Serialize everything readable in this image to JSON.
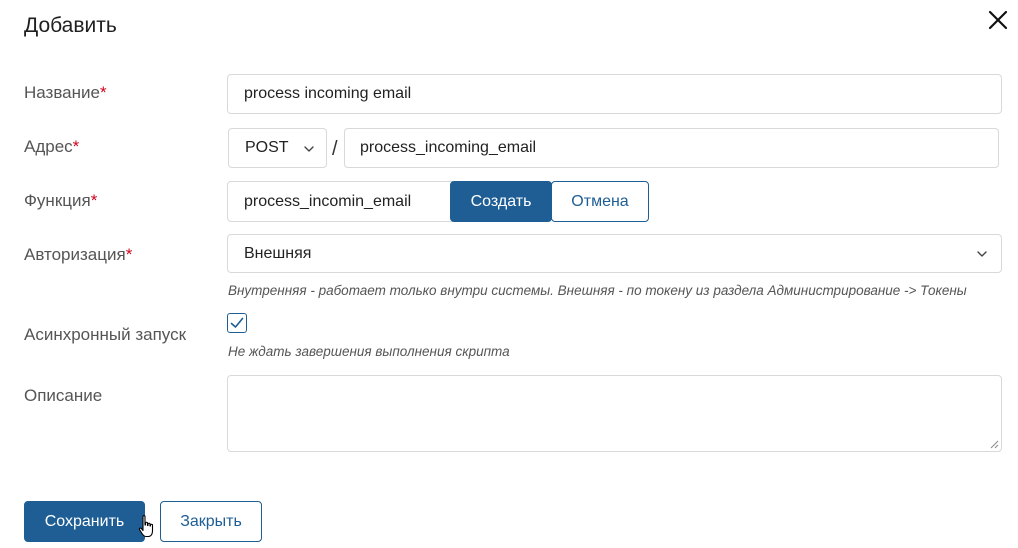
{
  "dialog": {
    "title": "Добавить",
    "close_icon": "close-icon"
  },
  "fields": {
    "name": {
      "label": "Название",
      "required_mark": "*",
      "value": "process incoming email"
    },
    "address": {
      "label": "Адрес",
      "required_mark": "*",
      "method": "POST",
      "separator": "/",
      "path": "process_incoming_email"
    },
    "function": {
      "label": "Функция",
      "required_mark": "*",
      "value": "process_incomin_email",
      "create_label": "Создать",
      "cancel_label": "Отмена"
    },
    "authorization": {
      "label": "Авторизация",
      "required_mark": "*",
      "value": "Внешняя",
      "hint": "Внутренняя - работает только внутри системы. Внешняя - по токену из раздела Администрирование -> Токены"
    },
    "async": {
      "label": "Асинхронный запуск",
      "checked": true,
      "hint": "Не ждать завершения выполнения скрипта"
    },
    "description": {
      "label": "Описание",
      "value": ""
    }
  },
  "footer": {
    "save_label": "Сохранить",
    "close_label": "Закрыть"
  },
  "colors": {
    "primary": "#1e5e94",
    "required": "#d0021b",
    "border": "#d9d9d9"
  }
}
